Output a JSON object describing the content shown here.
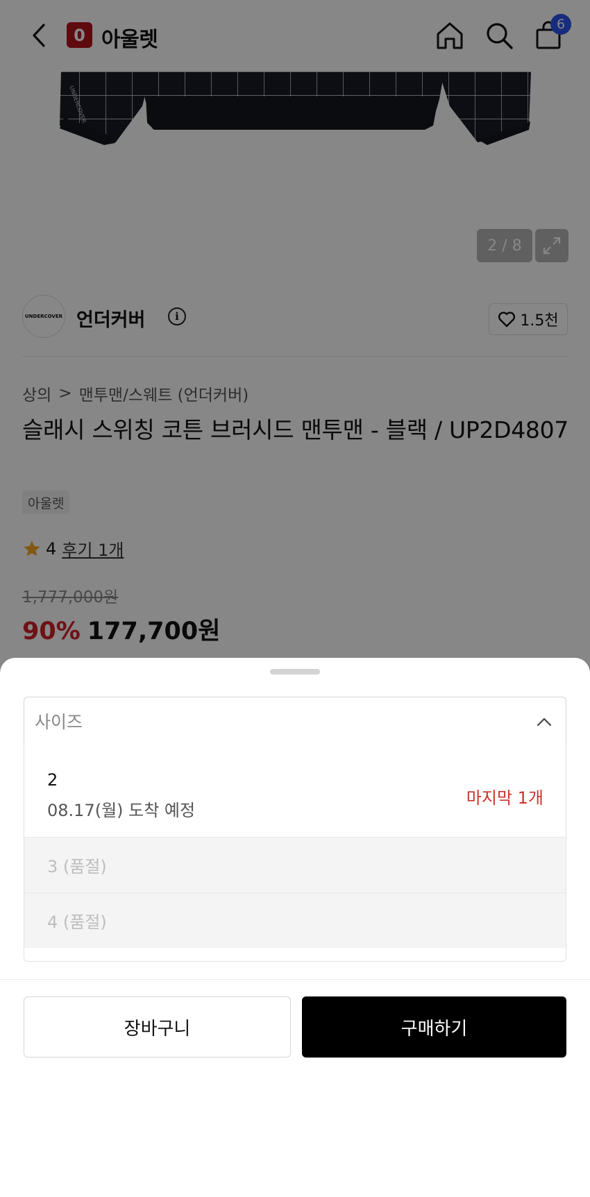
{
  "header": {
    "brand_badge": "0",
    "brand_name": "아울렛",
    "cart_count": "6"
  },
  "gallery": {
    "counter": "2 / 8"
  },
  "brand": {
    "logo_text": "UNDERCOVER",
    "name": "언더커버",
    "info_symbol": "i",
    "likes": "1.5천"
  },
  "breadcrumb": {
    "category": "상의",
    "separator": ">",
    "subcategory": "맨투맨/스웨트 (언더커버)"
  },
  "product": {
    "title": "슬래시 스위칭 코튼 브러시드 맨투맨 - 블랙 / UP2D4807",
    "store_tag": "아울렛",
    "rating": "4",
    "reviews": "후기 1개",
    "original_price": "1,777,000원",
    "discount": "90%",
    "price": "177,700원"
  },
  "sheet": {
    "select_placeholder": "사이즈",
    "options": [
      {
        "size": "2",
        "arrival": "08.17(월) 도착 예정",
        "stock": "마지막 1개"
      },
      {
        "label": "3 (품절)"
      },
      {
        "label": "4 (품절)"
      }
    ],
    "cart_button": "장바구니",
    "buy_button": "구매하기"
  },
  "colors": {
    "brand_red": "#b3141b",
    "discount_red": "#d1202a",
    "stock_red": "#c9332b",
    "badge_blue": "#2f54eb",
    "buy_black": "#000000"
  },
  "icons": [
    "back-icon",
    "home-icon",
    "search-icon",
    "shopping-bag-icon",
    "expand-icon",
    "info-icon",
    "heart-icon",
    "chevron-right-icon",
    "star-icon",
    "chevron-up-icon"
  ]
}
